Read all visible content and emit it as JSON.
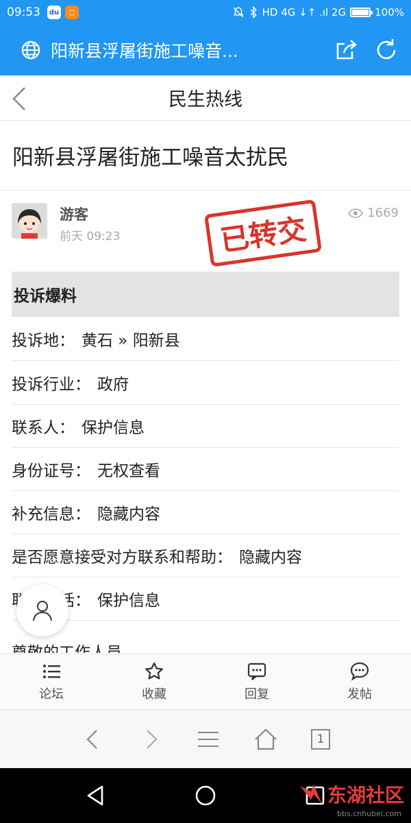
{
  "status_bar": {
    "time": "09:53",
    "network": "HD 4G ↓↑ .ıl 2G",
    "battery": "100%",
    "battery_level": 1.0,
    "app_badge_1": "du"
  },
  "browser": {
    "title": "阳新县浮屠街施工噪音...",
    "tab_count": "1"
  },
  "page_header": {
    "title": "民生热线"
  },
  "post": {
    "title": "阳新县浮屠街施工噪音太扰民",
    "author": "游客",
    "time": "前天 09:23",
    "views": "1669",
    "stamp_text": "已转交"
  },
  "section": {
    "heading": "投诉爆料",
    "rows": [
      {
        "label": "投诉地：",
        "value": "黄石 » 阳新县"
      },
      {
        "label": "投诉行业：",
        "value": "政府"
      },
      {
        "label": "联系人：",
        "value": "保护信息"
      },
      {
        "label": "身份证号：",
        "value": "无权查看"
      },
      {
        "label": "补充信息：",
        "value": "隐藏内容"
      },
      {
        "label": "是否愿意接受对方联系和帮助：",
        "value": "隐藏内容"
      },
      {
        "label": "联系电话：",
        "value": "保护信息"
      }
    ],
    "partial_text": "尊敬的工作人员"
  },
  "forum_nav": [
    {
      "label": "论坛",
      "icon": "list-icon"
    },
    {
      "label": "收藏",
      "icon": "star-icon"
    },
    {
      "label": "回复",
      "icon": "reply-icon"
    },
    {
      "label": "发帖",
      "icon": "post-icon"
    }
  ],
  "watermark": {
    "text": "东湖社区",
    "url": "bbs.cnhubei.com"
  },
  "colors": {
    "primary_blue": "#2196f3",
    "stamp_red": "#d9342b"
  }
}
